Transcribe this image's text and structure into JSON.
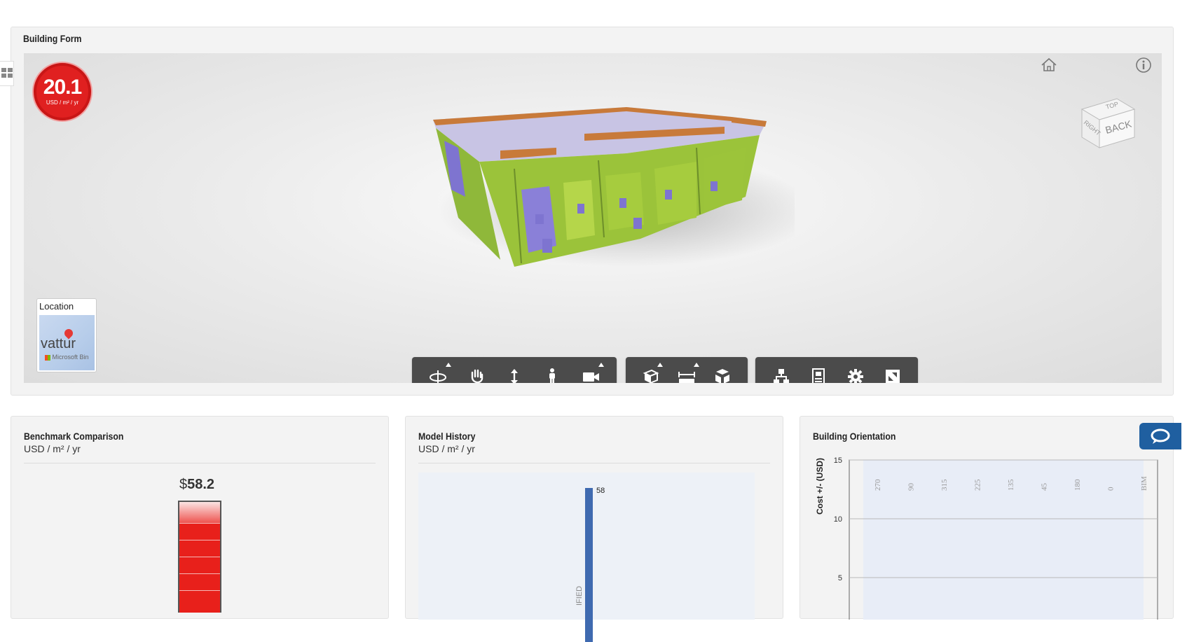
{
  "top_panel": {
    "title": "Building Form",
    "cost_badge": {
      "value": "20.1",
      "unit": "USD / m² / yr"
    },
    "viewcube": {
      "faces": [
        "TOP",
        "RIGHT",
        "BACK"
      ]
    },
    "location": {
      "label": "Location",
      "place": "vattur",
      "map_provider": "Microsoft Bin"
    },
    "toolbar": {
      "groups": [
        [
          "orbit-icon",
          "pan-icon",
          "zoom-icon",
          "walk-icon",
          "camera-icon"
        ],
        [
          "section-icon",
          "measure-icon",
          "explode-icon"
        ],
        [
          "model-browser-icon",
          "properties-icon",
          "settings-icon",
          "fullscreen-icon"
        ]
      ]
    }
  },
  "benchmark": {
    "title": "Benchmark Comparison",
    "subtitle": "USD / m² / yr",
    "value_currency": "$",
    "value": "58.2"
  },
  "history": {
    "title": "Model History",
    "subtitle": "USD / m² / yr",
    "chart_data": {
      "type": "bar",
      "categories": [
        "IFIED"
      ],
      "values": [
        58
      ],
      "data_labels": [
        "58"
      ]
    }
  },
  "orientation": {
    "title": "Building Orientation",
    "chart_data": {
      "type": "bar",
      "ylabel": "Cost +/- (USD)",
      "yticks": [
        "15",
        "10",
        "5"
      ],
      "categories": [
        "270",
        "90",
        "315",
        "225",
        "135",
        "45",
        "180",
        "0",
        "BIM"
      ],
      "ylim_top": 15
    }
  },
  "colors": {
    "badge_red": "#e02020",
    "bar_blue": "#3f6ab0",
    "help_blue": "#1f5fa0",
    "toolbar_bg": "#4b4b4b"
  }
}
